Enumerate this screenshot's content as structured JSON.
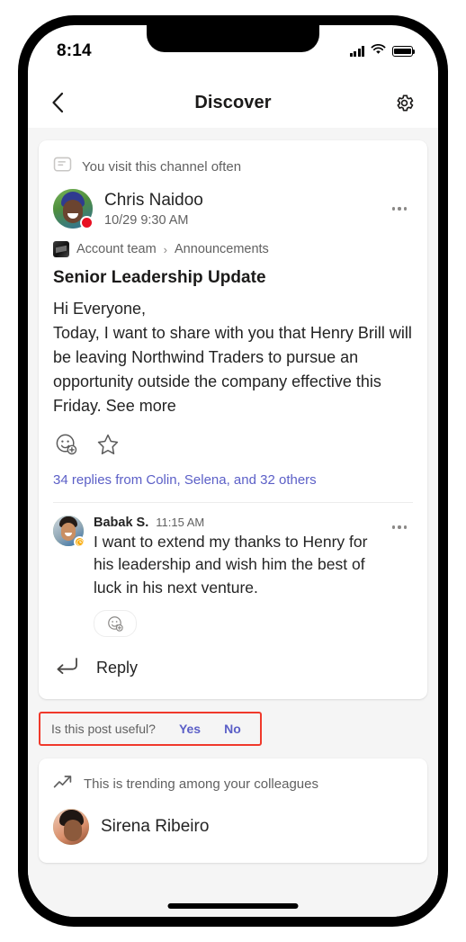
{
  "status_bar": {
    "time": "8:14",
    "signal_icon": "cellular-signal-icon",
    "wifi_icon": "wifi-icon",
    "battery_icon": "battery-full-icon"
  },
  "app_bar": {
    "back_icon": "back-chevron-icon",
    "title": "Discover",
    "settings_icon": "gear-icon"
  },
  "feed": {
    "post_card": {
      "hint_icon": "channel-feed-icon",
      "hint_text": "You visit this channel often",
      "author": "Chris Naidoo",
      "timestamp": "10/29 9:30 AM",
      "presence": "busy",
      "avatar_icon": "avatar",
      "more_icon": "overflow-menu-icon",
      "breadcrumb": {
        "team_icon": "team-avatar-icon",
        "team": "Account team",
        "separator": "›",
        "channel": "Announcements"
      },
      "title": "Senior Leadership Update",
      "body": "Hi Everyone,\nToday, I want to share with you that Henry Brill will be leaving Northwind Traders to pursue an opportunity outside the company effective this Friday. See more",
      "reactions": {
        "add_reaction_icon": "add-reaction-icon",
        "save_icon": "star-save-icon"
      },
      "replies_link": "34 replies from Colin, Selena, and 32 others",
      "reply": {
        "author": "Babak S.",
        "timestamp": "11:15 AM",
        "presence": "away",
        "avatar_icon": "avatar",
        "more_icon": "overflow-menu-icon",
        "text": "I want to extend my thanks to Henry for his leadership and wish him the best of luck in his next venture.",
        "add_reaction_icon": "add-reaction-icon"
      },
      "reply_action": {
        "icon": "reply-arrow-icon",
        "label": "Reply"
      }
    },
    "feedback": {
      "question": "Is this post useful?",
      "yes_label": "Yes",
      "no_label": "No",
      "highlight_color": "#f0392b"
    },
    "trending_card": {
      "icon": "trending-up-icon",
      "text": "This is trending among your colleagues",
      "person_name": "Sirena Ribeiro",
      "avatar_icon": "avatar"
    }
  },
  "colors": {
    "accent": "#5b5fc7",
    "busy": "#e81123",
    "away": "#f8a800",
    "text_primary": "#242424",
    "text_secondary": "#616161",
    "page_bg": "#f5f5f5"
  },
  "home_indicator": "home-indicator"
}
